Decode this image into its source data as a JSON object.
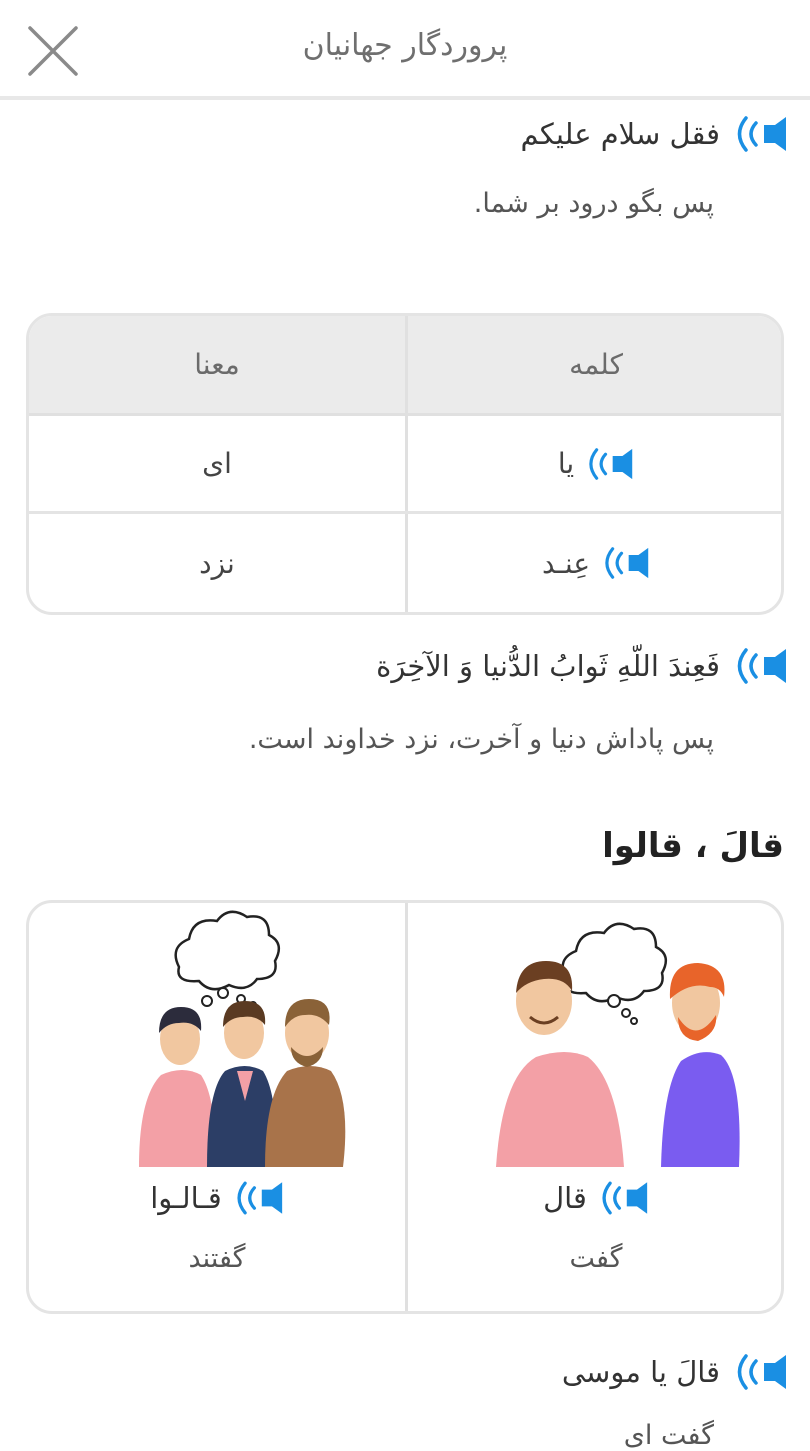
{
  "header": {
    "title": "پروردگار جهانیان",
    "close_icon": "close-icon"
  },
  "verses": [
    {
      "arabic": "فقل سلام علیکم",
      "translation": "پس بگو درود بر شما."
    },
    {
      "arabic": "فَعِندَ اللّهِ ثَوابُ الدُّنیا وَ الآخِرَة",
      "translation": "پس پاداش دنیا و آخرت، نزد خداوند است."
    },
    {
      "arabic": "قالَ یا موسی",
      "translation": "گفت ای"
    }
  ],
  "vocab_table": {
    "header_word": "کلمه",
    "header_meaning": "معنا",
    "rows": [
      {
        "word": "یا",
        "meaning": "ای"
      },
      {
        "word": "عِنـد",
        "meaning": "نزد"
      }
    ]
  },
  "section": {
    "title": "قالَ ، قالوا"
  },
  "picture_card": {
    "items": [
      {
        "word": "قال",
        "meaning": "گفت"
      },
      {
        "word": "قـالـوا",
        "meaning": "گفتند"
      }
    ]
  },
  "colors": {
    "audio_blue": "#1a8fe3",
    "border": "#e4e4e4",
    "table_header_bg": "#ebebeb"
  },
  "icons": {
    "audio": "speaker-icon",
    "close": "close-icon"
  }
}
